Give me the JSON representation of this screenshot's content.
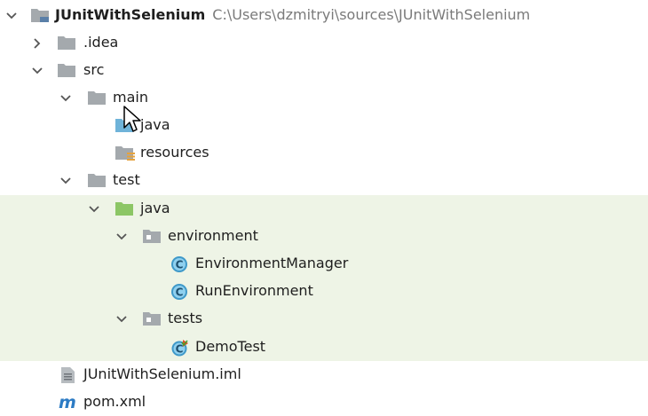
{
  "project": {
    "name": "JUnitWithSelenium",
    "path": "C:\\Users\\dzmitryi\\sources\\JUnitWithSelenium"
  },
  "nodes": {
    "idea": ".idea",
    "src": "src",
    "main": "main",
    "main_java": "java",
    "resources": "resources",
    "test": "test",
    "test_java": "java",
    "environment": "environment",
    "environment_manager": "EnvironmentManager",
    "run_environment": "RunEnvironment",
    "tests": "tests",
    "demo_test": "DemoTest",
    "iml_file": "JUnitWithSelenium.iml",
    "pom_file": "pom.xml"
  },
  "icons": {
    "folder": "folder-icon",
    "source_root": "source-root-folder-icon",
    "resources_root": "resources-folder-icon",
    "test_root": "test-root-folder-icon",
    "package": "package-icon",
    "class": "class-icon",
    "test_class": "test-class-icon",
    "module_file": "iml-file-icon",
    "maven": "maven-file-icon"
  },
  "colors": {
    "test_highlight": "#eef4e6",
    "folder_gray": "#a4a9ad",
    "source_blue": "#6fb3d9",
    "test_green": "#8cc665",
    "class_circle": "#3f99c9",
    "path_gray": "#7a7a7a"
  }
}
